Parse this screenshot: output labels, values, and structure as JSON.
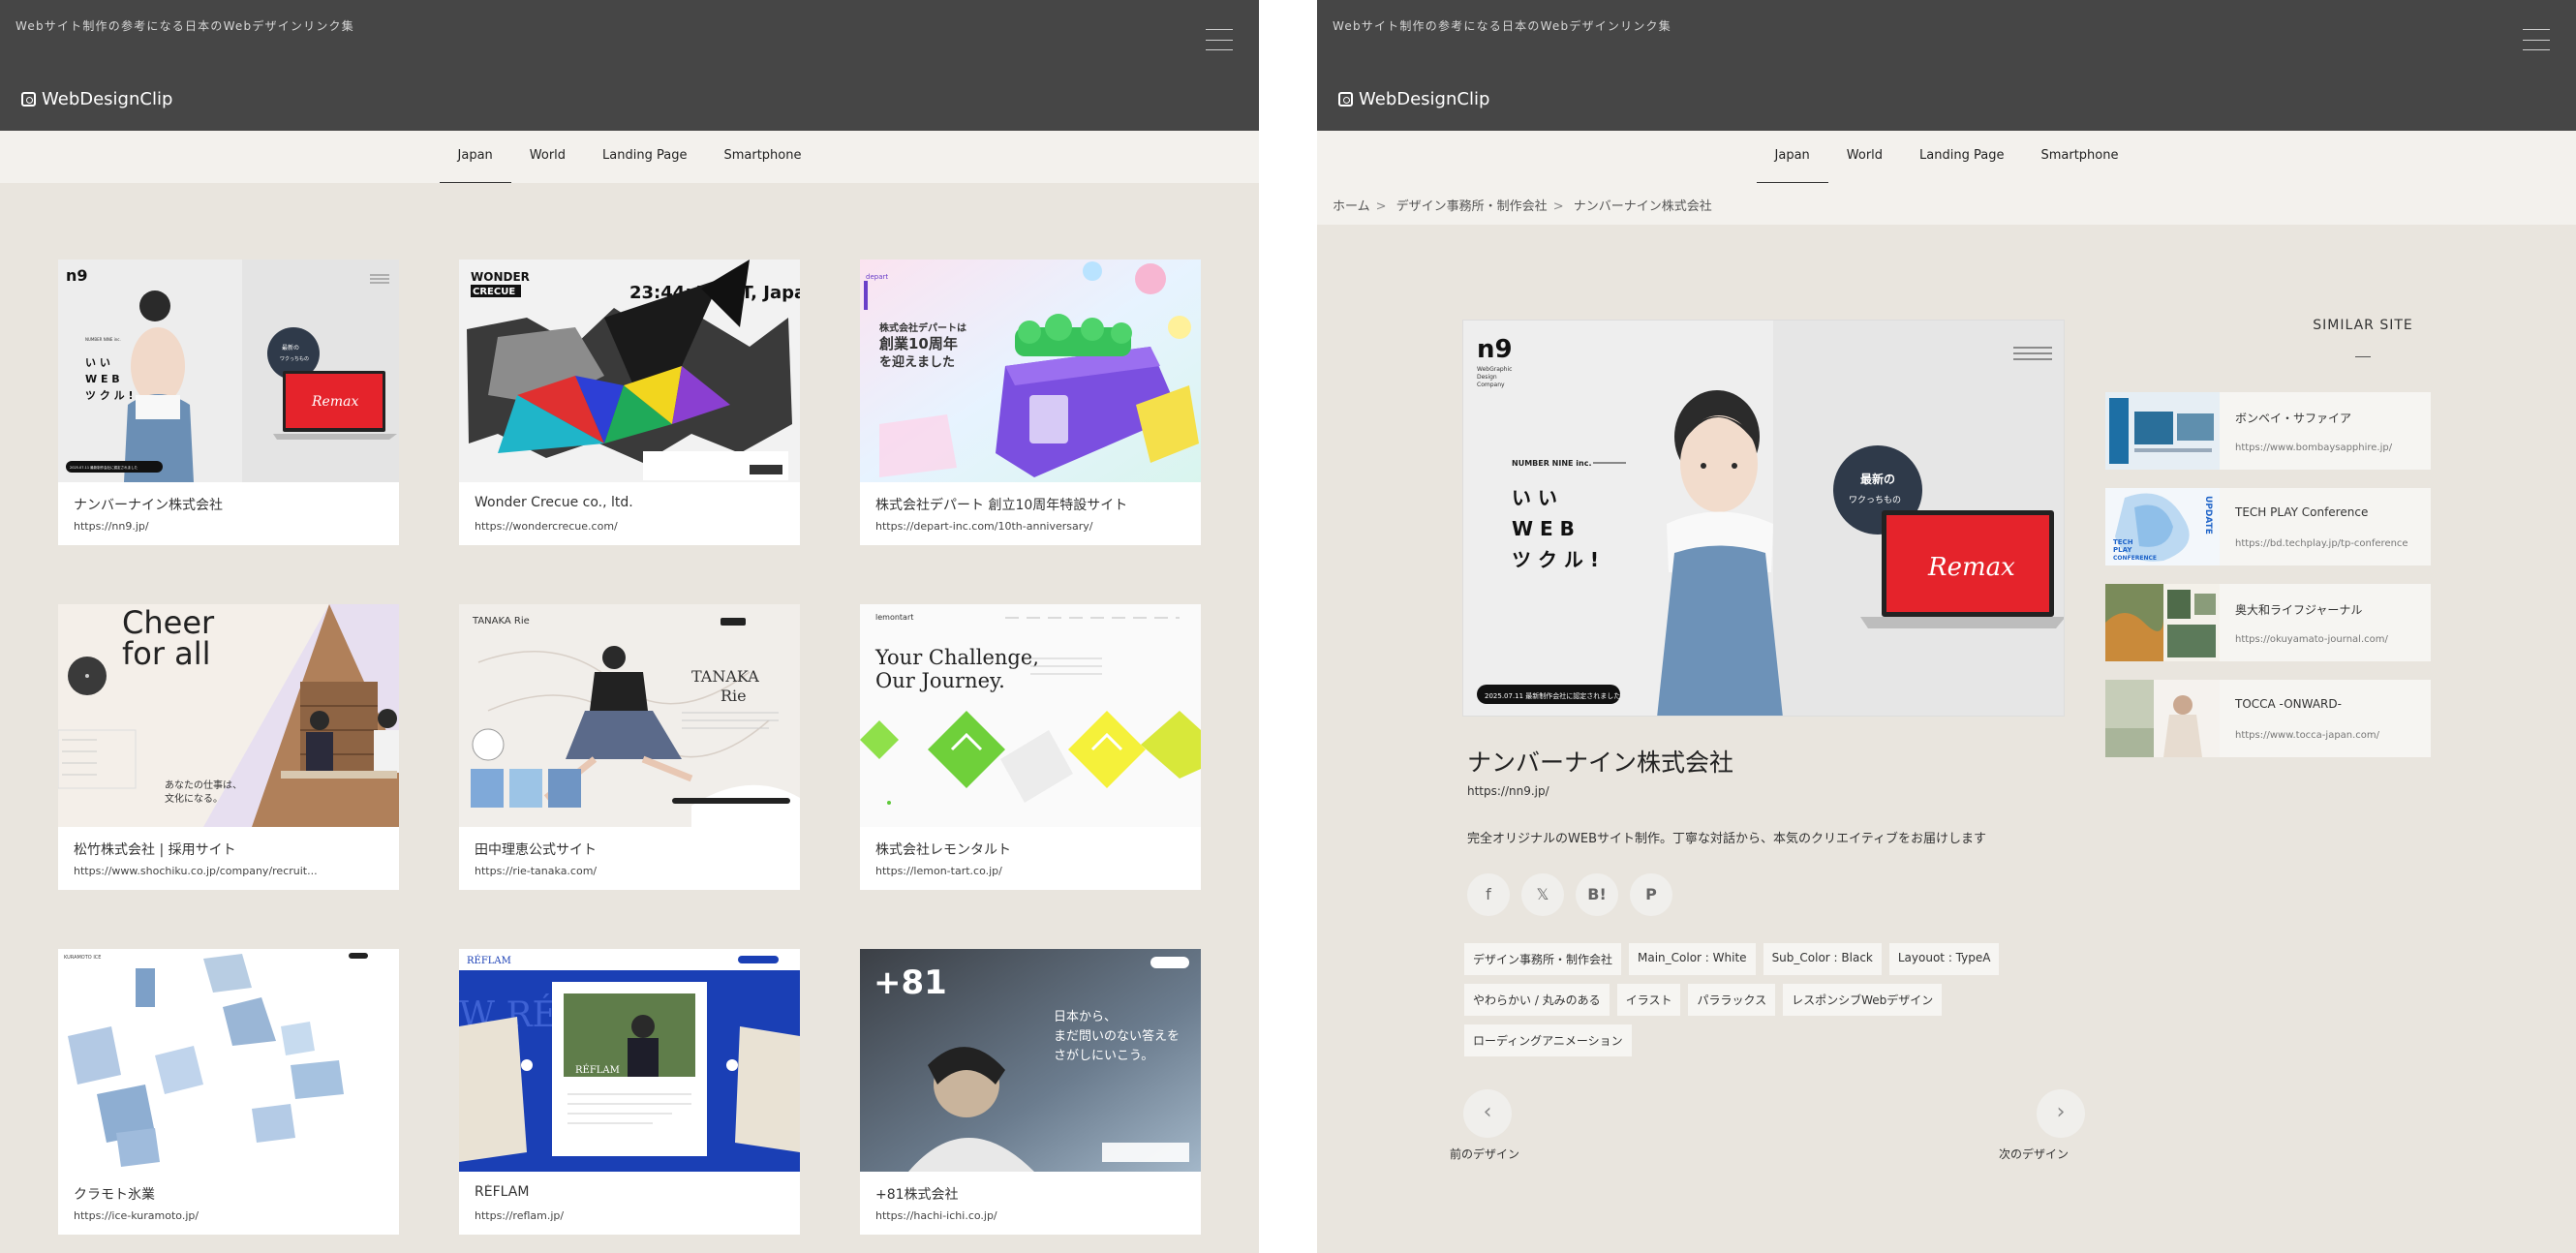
{
  "header": {
    "tagline": "Webサイト制作の参考になる日本のWebデザインリンク集",
    "logo": "WebDesignClip"
  },
  "tabs": [
    {
      "label": "Japan",
      "active": true
    },
    {
      "label": "World",
      "active": false
    },
    {
      "label": "Landing Page",
      "active": false
    },
    {
      "label": "Smartphone",
      "active": false
    }
  ],
  "listing": [
    {
      "title": "ナンバーナイン株式会社",
      "url": "https://nn9.jp/"
    },
    {
      "title": "Wonder Crecue co., ltd.",
      "url": "https://wondercrecue.com/"
    },
    {
      "title": "株式会社デパート 創立10周年特設サイト",
      "url": "https://depart-inc.com/10th-anniversary/"
    },
    {
      "title": "松竹株式会社 | 採用サイト",
      "url": "https://www.shochiku.co.jp/company/recruit..."
    },
    {
      "title": "田中理恵公式サイト",
      "url": "https://rie-tanaka.com/"
    },
    {
      "title": "株式会社レモンタルト",
      "url": "https://lemon-tart.co.jp/"
    },
    {
      "title": "クラモト氷業",
      "url": "https://ice-kuramoto.jp/"
    },
    {
      "title": "RÉFLAM",
      "url": "https://reflam.jp/"
    },
    {
      "title": "+81株式会社",
      "url": "https://hachi-ichi.co.jp/"
    }
  ],
  "thumbs": {
    "nn9": {
      "brand": "n9",
      "company": "NUMBER NINE inc.",
      "catch": [
        "い い",
        "W E B",
        "ツ ク ル !"
      ],
      "bubble": [
        "最新の",
        "ワクっちもの"
      ],
      "screen": "Remax",
      "badge": "2025.07.11 最新制作会社に認定されました"
    },
    "wonder": {
      "brand": "WONDER",
      "brand2": "CRECUE",
      "clock": "23:44:49 JST, Japan"
    },
    "depart": {
      "headline": [
        "株式会社デパートは",
        "創業10周年",
        "を迎えました"
      ],
      "logo": "depart"
    },
    "shochiku": {
      "headline": [
        "Cheer",
        "for all"
      ],
      "copy": [
        "あなたの仕事は、",
        "文化になる。"
      ]
    },
    "tanaka": {
      "brand": "TANAKA Rie",
      "name": [
        "TANAKA",
        "Rie"
      ]
    },
    "lemon": {
      "brand": "lemontart",
      "headline": [
        "Your Challenge,",
        "Our Journey."
      ]
    },
    "kuramoto": {
      "brand": "KURAMOTO ICE"
    },
    "reflam": {
      "brand": "RÉFLAM",
      "bg": "W RÉ RVIEW",
      "caption": "RÉFLAM"
    },
    "hachi": {
      "brand": "+81",
      "copy": [
        "日本から、",
        "まだ問いのない答えを",
        "さがしにいこう。"
      ]
    }
  },
  "breadcrumb": [
    "ホーム",
    "デザイン事務所・制作会社",
    "ナンバーナイン株式会社"
  ],
  "breadcrumb_sep": ">",
  "detail": {
    "title": "ナンバーナイン株式会社",
    "url": "https://nn9.jp/",
    "description": "完全オリジナルのWEBサイト制作。丁寧な対話から、本気のクリエイティブをお届けします",
    "share": [
      {
        "icon": "facebook-icon",
        "glyph": "f"
      },
      {
        "icon": "x-icon",
        "glyph": "𝕏"
      },
      {
        "icon": "hatena-bookmark-icon",
        "glyph": "B!"
      },
      {
        "icon": "pinterest-icon",
        "glyph": "P"
      }
    ],
    "tags": [
      "デザイン事務所・制作会社",
      "Main_Color : White",
      "Sub_Color : Black",
      "Layouot : TypeA",
      "やわらかい / 丸みのある",
      "イラスト",
      "パララックス",
      "レスポンシブWebデザイン",
      "ローディングアニメーション"
    ],
    "prev_label": "前のデザイン",
    "next_label": "次のデザイン",
    "hero": {
      "brand": "n9",
      "brand_sub": [
        "WebGraphic",
        "Design",
        "Company"
      ],
      "company": "NUMBER NINE inc.",
      "catch": [
        "い い",
        "W E B",
        "ツ ク ル !"
      ],
      "bubble": [
        "最新の",
        "ワクっちもの"
      ],
      "screen": "Remax",
      "badge": "2025.07.11 最新制作会社に認定されました"
    }
  },
  "similar": {
    "title": "SIMILAR SITE",
    "items": [
      {
        "title": "ボンベイ・サファイア",
        "url": "https://www.bombaysapphire.jp/"
      },
      {
        "title": "TECH PLAY Conference",
        "url": "https://bd.techplay.jp/tp-conference"
      },
      {
        "title": "奥大和ライフジャーナル",
        "url": "https://okuyamato-journal.com/"
      },
      {
        "title": "TOCCA -ONWARD-",
        "url": "https://www.tocca-japan.com/"
      }
    ],
    "thumb_text": {
      "tech": "UPDATE",
      "tech_conf": [
        "TECH",
        "PLAY",
        "CONFERENCE"
      ]
    }
  },
  "colors": {
    "header_bg": "#464646",
    "page_bg": "#e9e5de",
    "nav_bg": "#f3f1ed",
    "remax_red": "#e5232b",
    "reflam_blue": "#1a3fb5"
  }
}
